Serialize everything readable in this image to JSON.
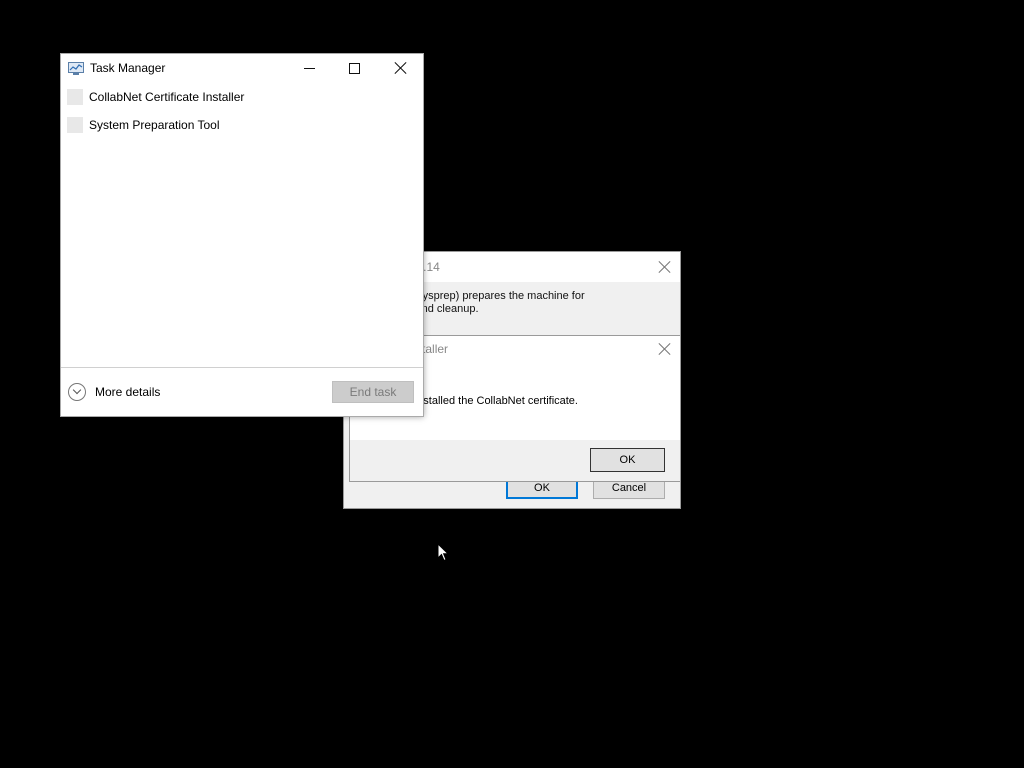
{
  "sysprep_window": {
    "title": "ration Tool 3.14",
    "description": "ration Tool (Sysprep) prepares the machine for\nependence and cleanup.",
    "ok_label": "OK",
    "cancel_label": "Cancel"
  },
  "cert_dialog": {
    "title": "rtificate Installer",
    "message": "ccessfully installed the CollabNet certificate.",
    "ok_label": "OK"
  },
  "task_manager": {
    "title": "Task Manager",
    "apps": [
      {
        "label": "CollabNet Certificate Installer"
      },
      {
        "label": "System Preparation Tool"
      }
    ],
    "more_details_label": "More details",
    "end_task_label": "End task"
  }
}
